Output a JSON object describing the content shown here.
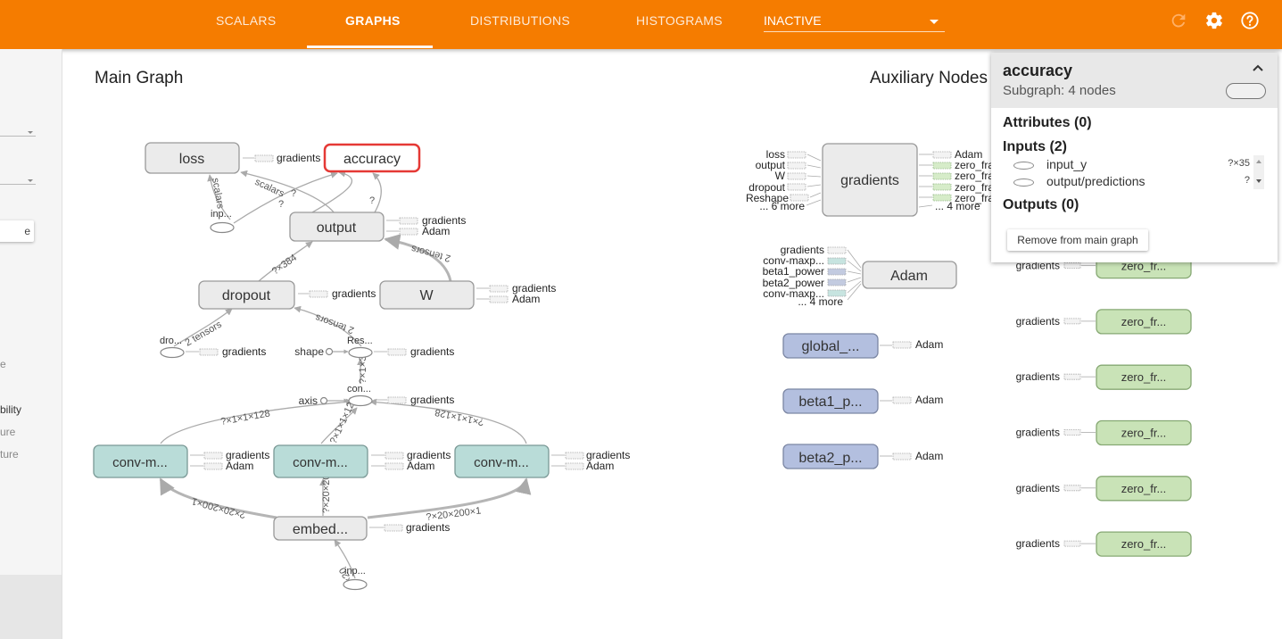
{
  "topbar": {
    "tabs": [
      {
        "label": "SCALARS"
      },
      {
        "label": "GRAPHS"
      },
      {
        "label": "DISTRIBUTIONS"
      },
      {
        "label": "HISTOGRAMS"
      }
    ],
    "active_tab": "GRAPHS",
    "run_select_value": "INACTIVE",
    "icons": [
      "refresh-icon",
      "gear-icon",
      "help-icon"
    ],
    "accent_color": "#f57c00"
  },
  "sidebar": {
    "button_label": "e",
    "text_fragments": [
      "e",
      "bility",
      "ure",
      "ture"
    ]
  },
  "graph": {
    "main_title": "Main Graph",
    "aux_title": "Auxiliary Nodes",
    "nodes": {
      "loss": "loss",
      "accuracy": "accuracy",
      "output": "output",
      "dropout": "dropout",
      "W": "W",
      "conv1": "conv-m...",
      "conv2": "conv-m...",
      "conv3": "conv-m...",
      "embed": "embed...",
      "inp_top": "inp...",
      "dro": "dro...",
      "res": "Res...",
      "con": "con...",
      "inp_bottom": "inp...",
      "shape": "shape",
      "axis": "axis"
    },
    "edge_labels": {
      "scalars": "scalars",
      "scalars2": "scalars",
      "q1": "?",
      "q2": "?",
      "q3": "?",
      "t384": "?×384",
      "tensors2a": "2 tensors",
      "tensors2b": "2 tensors",
      "tensors2c": "2 tensors",
      "t1x3": "?×1×3",
      "t128a": "?×1×1×128",
      "t128b": "?×1×1×128",
      "t128c": "?×1×1×128",
      "t200a": "?×20×200×1",
      "t200b": "?×20×200",
      "t200c": "?×20×200×1",
      "t20": "?×20"
    },
    "gradients": "gradients",
    "adam": "Adam",
    "aux": {
      "gradients_node": "gradients",
      "gradients_inputs": [
        "loss",
        "output",
        "W",
        "dropout",
        "Reshape",
        "... 6 more"
      ],
      "gradients_outputs": [
        "Adam",
        "zero_fractio",
        "zero_fracti",
        "zero_fracti",
        "zero_fracti",
        "... 4 more"
      ],
      "adam_node": "Adam",
      "adam_inputs": [
        "gradients",
        "conv-maxp...",
        "beta1_power",
        "beta2_power",
        "conv-maxp...",
        "... 4 more"
      ],
      "global": "global_...",
      "beta1": "beta1_p...",
      "beta2": "beta2_p...",
      "zero_label": "zero_fr...",
      "zero_rows": 8
    }
  },
  "info_card": {
    "title": "accuracy",
    "subtitle": "Subgraph: 4 nodes",
    "attributes": "Attributes (0)",
    "inputs": "Inputs (2)",
    "input_rows": [
      {
        "name": "input_y",
        "shape": "?×35"
      },
      {
        "name": "output/predictions",
        "shape": "?"
      }
    ],
    "outputs": "Outputs (0)",
    "remove_button": "Remove from main graph"
  }
}
